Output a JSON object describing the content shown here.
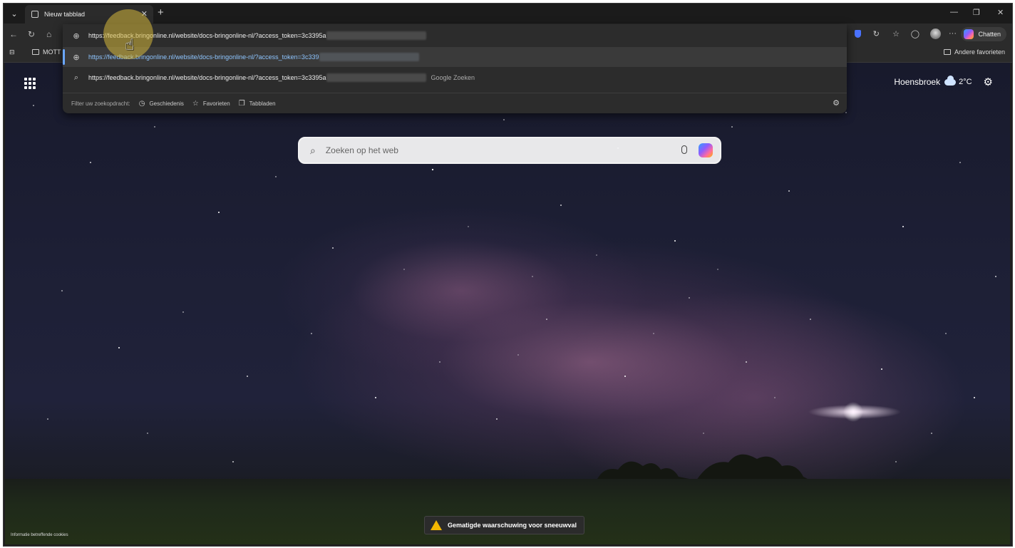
{
  "tab": {
    "title": "Nieuw tabblad"
  },
  "address": {
    "typed_url": "https://feedback.bringonline.nl/website/docs-bringonline-nl/?access_token=3c3395a",
    "suggestion_url": "https://feedback.bringonline.nl/website/docs-bringonline-nl/?access_token=3c339",
    "search_query": "https://feedback.bringonline.nl/website/docs-bringonline-nl/?access_token=3c3395a",
    "search_suffix": "Google Zoeken"
  },
  "filter": {
    "label": "Filter uw zoekopdracht:",
    "chips": [
      "Geschiedenis",
      "Favorieten",
      "Tabbladen"
    ]
  },
  "toolbar": {
    "chat_label": "Chatten"
  },
  "favorites": {
    "folder_label": "MOTT",
    "other_favorites": "Andere favorieten"
  },
  "weather": {
    "location": "Hoensbroek",
    "temperature": "2°C"
  },
  "search": {
    "placeholder": "Zoeken op het web"
  },
  "alert": {
    "text": "Gematigde waarschuwing voor sneeuwval"
  },
  "footer": {
    "cookie_note": "Informatie betreffende cookies"
  }
}
